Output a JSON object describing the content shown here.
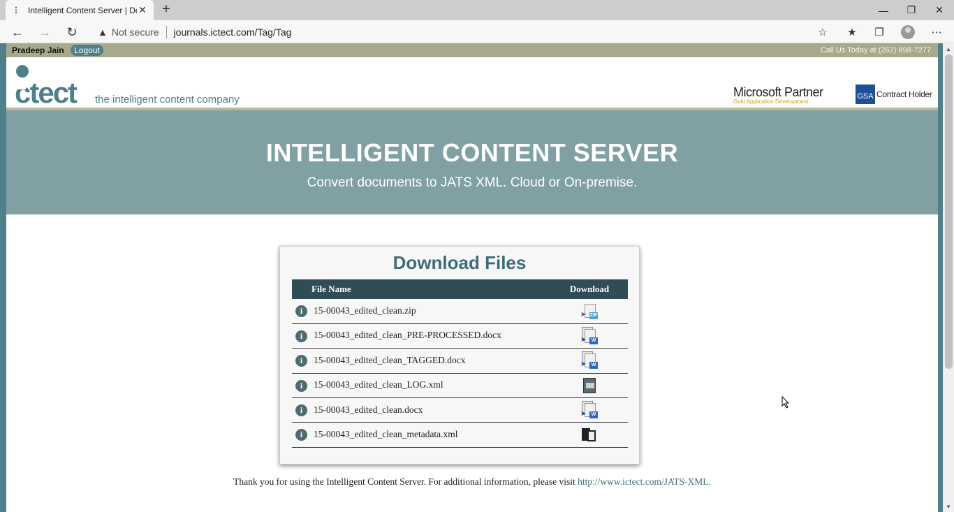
{
  "browser": {
    "tab_title": "Intelligent Content Server | Dow",
    "tab_close": "✕",
    "new_tab": "+",
    "security": "Not secure",
    "url": "journals.ictect.com/Tag/Tag"
  },
  "topstrip": {
    "user": "Pradeep Jain",
    "logout": "Logout",
    "call": "Call Us Today at (262) 898-7277"
  },
  "header": {
    "tagline": "the intelligent content company",
    "ms_partner": "Microsoft Partner",
    "ms_sub": "Gold Application Development",
    "gsa_box": "GSA",
    "gsa_text": "Contract Holder"
  },
  "banner": {
    "title": "INTELLIGENT CONTENT SERVER",
    "subtitle": "Convert documents to JATS XML. Cloud or On-premise."
  },
  "download": {
    "title": "Download Files",
    "col_name": "File Name",
    "col_download": "Download",
    "info_glyph": "i",
    "files": [
      {
        "name": "15-00043_edited_clean.zip",
        "icon": "zip-file-icon"
      },
      {
        "name": "15-00043_edited_clean_PRE-PROCESSED.docx",
        "icon": "word-file-icon"
      },
      {
        "name": "15-00043_edited_clean_TAGGED.docx",
        "icon": "word-file-icon"
      },
      {
        "name": "15-00043_edited_clean_LOG.xml",
        "icon": "log-file-icon"
      },
      {
        "name": "15-00043_edited_clean.docx",
        "icon": "word-file-icon"
      },
      {
        "name": "15-00043_edited_clean_metadata.xml",
        "icon": "xml-file-icon"
      }
    ]
  },
  "footer": {
    "text": "Thank you for using the Intelligent Content Server. For additional information, please visit ",
    "link": "http://www.ictect.com/JATS-XML."
  }
}
